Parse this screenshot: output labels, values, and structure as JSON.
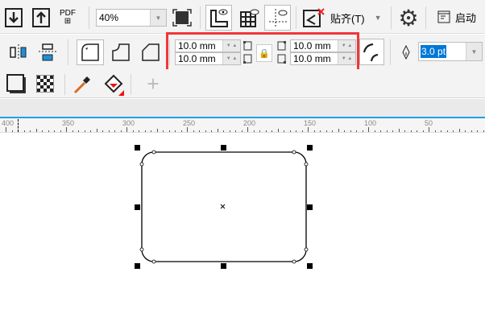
{
  "toolbar": {
    "zoom_value": "40%",
    "pdf_label": "PDF",
    "snap_label": "贴齐(T)",
    "launch_label": "启动",
    "icons": [
      "import-icon",
      "export-icon",
      "publish-pdf-icon",
      "full-screen-icon",
      "rulers-icon",
      "grid-icon",
      "guidelines-icon",
      "snap-off-icon",
      "settings-icon",
      "launch-icon"
    ]
  },
  "property_bar": {
    "corner_radius": {
      "top_left": "10.0 mm",
      "bottom_left": "10.0 mm",
      "top_right": "10.0 mm",
      "bottom_right": "10.0 mm",
      "locked": true
    },
    "outline_width": "3.0 pt",
    "icons": [
      "mirror-horizontal-icon",
      "mirror-vertical-icon",
      "round-corner-icon",
      "scalloped-corner-icon",
      "chamfered-corner-icon",
      "lock-icon",
      "relative-corner-scaling-icon",
      "outline-pen-icon"
    ]
  },
  "tools": {
    "icons": [
      "drop-shadow-icon",
      "transparency-icon",
      "eyedropper-icon",
      "fill-icon",
      "add-icon"
    ]
  },
  "ruler": {
    "labels": [
      "400",
      "350",
      "300",
      "250",
      "200",
      "150",
      "100",
      "50"
    ]
  },
  "colors": {
    "highlight_box": "#f0373a",
    "ruler_accent": "#1aa3e8",
    "selection_text_bg": "#0078d7"
  }
}
